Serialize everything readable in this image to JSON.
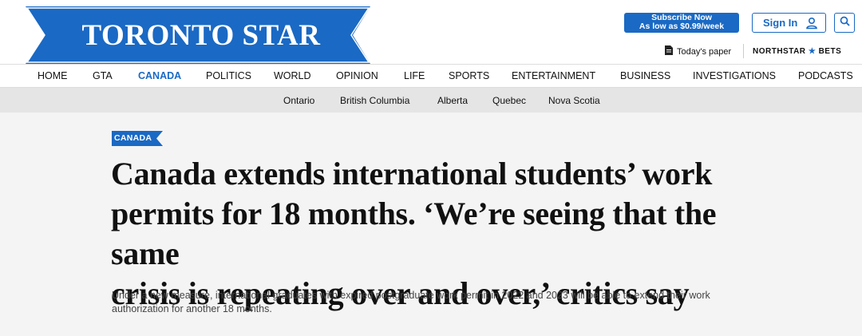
{
  "brand": {
    "logo_text": "TORONTO STAR",
    "accent_color": "#1a69c4"
  },
  "header": {
    "subscribe_line1": "Subscribe Now",
    "subscribe_line2": "As low as $0.99/week",
    "signin_label": "Sign In",
    "user_icon": "user-icon",
    "search_icon": "search-icon",
    "todays_paper_label": "Today's paper",
    "todays_paper_icon": "newspaper-icon",
    "northstar_label_a": "NORTHSTAR",
    "northstar_star": "★",
    "northstar_label_b": "BETS"
  },
  "main_nav": {
    "items": [
      {
        "label": "HOME"
      },
      {
        "label": "GTA"
      },
      {
        "label": "CANADA",
        "active": true
      },
      {
        "label": "POLITICS"
      },
      {
        "label": "WORLD"
      },
      {
        "label": "OPINION"
      },
      {
        "label": "LIFE"
      },
      {
        "label": "SPORTS"
      },
      {
        "label": "ENTERTAINMENT"
      },
      {
        "label": "BUSINESS"
      },
      {
        "label": "INVESTIGATIONS"
      },
      {
        "label": "PODCASTS"
      }
    ]
  },
  "sub_nav": {
    "items": [
      {
        "label": "Ontario"
      },
      {
        "label": "British Columbia"
      },
      {
        "label": "Alberta"
      },
      {
        "label": "Quebec"
      },
      {
        "label": "Nova Scotia"
      }
    ]
  },
  "article": {
    "section": "CANADA",
    "headline_lines": [
      "Canada extends international students’ work",
      "permits for 18 months. ‘We’re seeing that the same",
      "crisis is repeating over and over,’ critics say"
    ],
    "dek": "Under a new measure, international graduates with expired postgraduate work permit in 2022 and 2023 will be able to extend their work authorization for another 18 months."
  }
}
